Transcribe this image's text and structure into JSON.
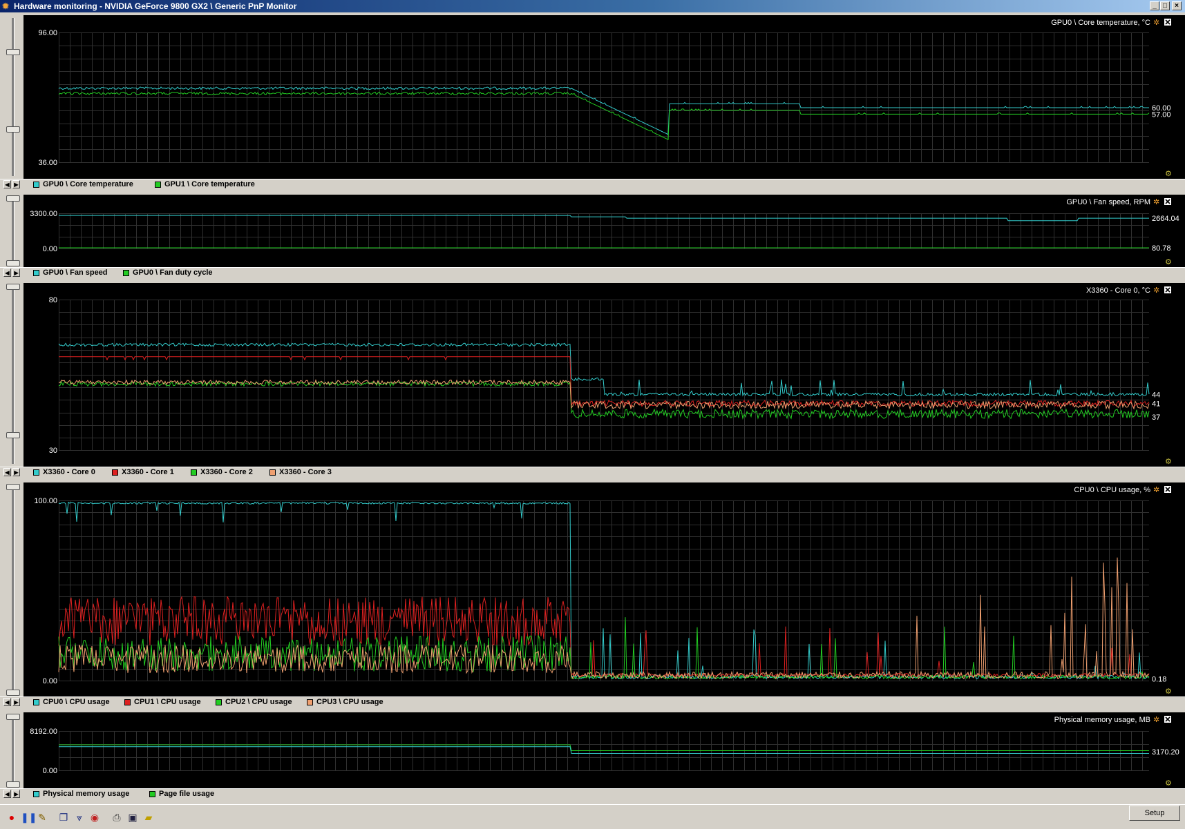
{
  "window": {
    "title": "Hardware monitoring - NVIDIA GeForce 9800 GX2 \\ Generic PnP Monitor",
    "app_icon": "flame-icon",
    "controls": [
      "minimize",
      "maximize",
      "close"
    ]
  },
  "colors": {
    "plot_bg": "#000000",
    "grid": "#303030",
    "cyan": "#33cccc",
    "green": "#22cc22",
    "red": "#dd2020",
    "orange": "#f0a070",
    "window_bg": "#d4d0c8"
  },
  "panels": [
    {
      "id": "gpu-temp",
      "title": "GPU0 \\ Core temperature, °C",
      "ymax": "96.00",
      "ymin": "36.00",
      "current_values": [
        "60.00",
        "57.00"
      ],
      "legend": [
        {
          "label": "GPU0 \\ Core temperature",
          "color": "#33cccc"
        },
        {
          "label": "GPU1 \\ Core temperature",
          "color": "#22cc22"
        }
      ]
    },
    {
      "id": "fan",
      "title": "GPU0 \\ Fan speed, RPM",
      "ymax": "3300.00",
      "ymin": "0.00",
      "current_values": [
        "2664.04",
        "80.78"
      ],
      "legend": [
        {
          "label": "GPU0 \\ Fan speed",
          "color": "#33cccc"
        },
        {
          "label": "GPU0 \\ Fan duty cycle",
          "color": "#22cc22"
        }
      ]
    },
    {
      "id": "cpu-temp",
      "title": "X3360 - Core 0, °C",
      "ymax": "80",
      "ymin": "30",
      "current_values": [
        "44",
        "41",
        "37"
      ],
      "legend": [
        {
          "label": "X3360 - Core 0",
          "color": "#33cccc"
        },
        {
          "label": "X3360 - Core 1",
          "color": "#dd2020"
        },
        {
          "label": "X3360 - Core 2",
          "color": "#22cc22"
        },
        {
          "label": "X3360 - Core 3",
          "color": "#f0a070"
        }
      ]
    },
    {
      "id": "cpu-usage",
      "title": "CPU0 \\ CPU usage, %",
      "ymax": "100.00",
      "ymin": "0.00",
      "current_values": [
        "0.18"
      ],
      "legend": [
        {
          "label": "CPU0 \\ CPU usage",
          "color": "#33cccc"
        },
        {
          "label": "CPU1 \\ CPU usage",
          "color": "#dd2020"
        },
        {
          "label": "CPU2 \\ CPU usage",
          "color": "#22cc22"
        },
        {
          "label": "CPU3 \\ CPU usage",
          "color": "#f0a070"
        }
      ]
    },
    {
      "id": "memory",
      "title": "Physical memory usage, MB",
      "ymax": "8192.00",
      "ymin": "0.00",
      "current_values": [
        "3170.20"
      ],
      "legend": [
        {
          "label": "Physical memory usage",
          "color": "#33cccc"
        },
        {
          "label": "Page file usage",
          "color": "#22cc22"
        }
      ]
    }
  ],
  "toolbar": {
    "icons": [
      "record-icon",
      "pause-icon",
      "clear-icon",
      "windows-icon",
      "collapse-icon",
      "monitor-icon",
      "print-icon",
      "save-icon",
      "open-folder-icon"
    ],
    "setup_label": "Setup"
  }
}
